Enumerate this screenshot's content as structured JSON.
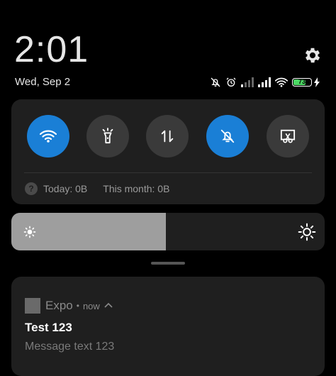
{
  "clock": {
    "time": "2:01",
    "date": "Wed, Sep 2"
  },
  "header": {
    "settings_icon": "gear-icon"
  },
  "status_bar": {
    "icons": [
      "notifications-muted-icon",
      "alarm-icon",
      "signal-weak-icon",
      "signal-icon",
      "wifi-icon",
      "battery-icon",
      "charging-icon"
    ],
    "battery_level": "73",
    "battery_fraction": 0.73
  },
  "quick_settings": {
    "tiles": [
      {
        "name": "wifi",
        "icon": "wifi-icon",
        "active": true
      },
      {
        "name": "flashlight",
        "icon": "flashlight-icon",
        "active": false
      },
      {
        "name": "mobile-data",
        "icon": "data-transfer-icon",
        "active": false
      },
      {
        "name": "mute",
        "icon": "bell-off-icon",
        "active": true
      },
      {
        "name": "screenshot",
        "icon": "scissors-screenshot-icon",
        "active": false
      }
    ],
    "data_usage": {
      "today": "Today: 0B",
      "this_month": "This month: 0B"
    }
  },
  "brightness": {
    "level": 0.494
  },
  "notification": {
    "app_name": "Expo",
    "time": "now",
    "title": "Test 123",
    "message": "Message text 123"
  },
  "colors": {
    "accent": "#1a7fd6",
    "panel": "#1f1f1f",
    "tile_off": "#3a3a3a",
    "battery": "#4cd964",
    "brightness_fill": "#9e9e9e"
  }
}
